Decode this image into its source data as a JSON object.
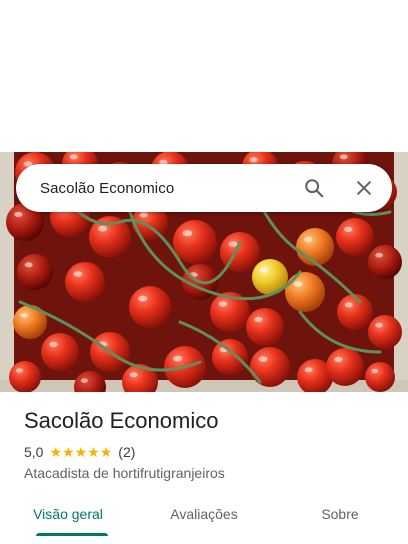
{
  "search": {
    "query": "Sacolão Economico"
  },
  "place": {
    "name": "Sacolão Economico",
    "rating": "5,0",
    "stars_filled": 5,
    "reviews_count": "(2)",
    "category": "Atacadista de hortifrutigranjeiros"
  },
  "tabs": [
    {
      "label": "Visão geral",
      "active": true
    },
    {
      "label": "Avaliações",
      "active": false
    },
    {
      "label": "Sobre",
      "active": false
    }
  ],
  "icons": {
    "search": "search-icon",
    "close": "close-icon",
    "star": "star-icon"
  },
  "colors": {
    "accent": "#00796b",
    "star": "#f4b400"
  }
}
